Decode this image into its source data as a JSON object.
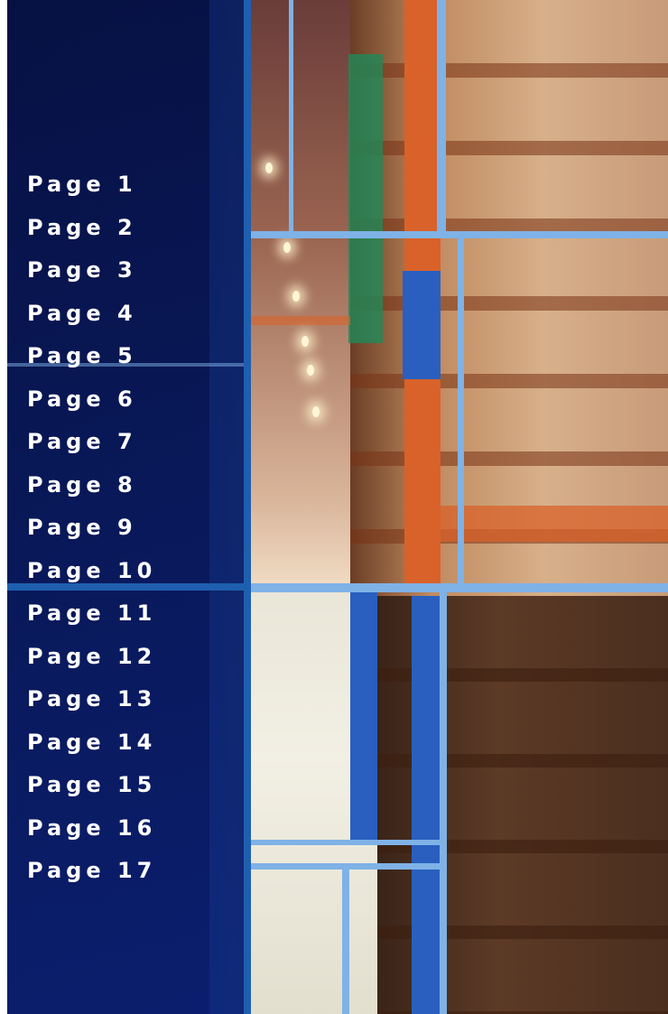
{
  "colors": {
    "panel": "#081860",
    "grid_line": "#7fb2e6",
    "text": "#ffffff"
  },
  "background_image": "warehouse-aisle-photo",
  "nav": {
    "items": [
      {
        "label": "Page 1"
      },
      {
        "label": "Page 2"
      },
      {
        "label": "Page 3"
      },
      {
        "label": "Page 4"
      },
      {
        "label": "Page 5"
      },
      {
        "label": "Page 6"
      },
      {
        "label": "Page 7"
      },
      {
        "label": "Page 8"
      },
      {
        "label": "Page 9"
      },
      {
        "label": "Page 10"
      },
      {
        "label": "Page 11"
      },
      {
        "label": "Page 12"
      },
      {
        "label": "Page 13"
      },
      {
        "label": "Page 14"
      },
      {
        "label": "Page 15"
      },
      {
        "label": "Page 16"
      },
      {
        "label": "Page 17"
      }
    ]
  }
}
